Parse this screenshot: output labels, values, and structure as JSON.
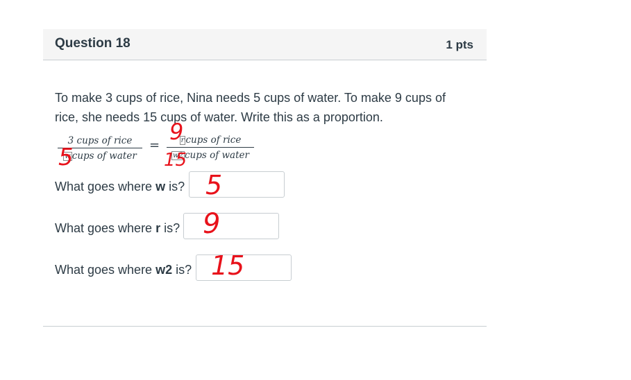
{
  "question": {
    "title": "Question 18",
    "points": "1 pts",
    "text": "To make 3 cups of rice, Nina needs 5 cups of water. To make 9 cups of rice, she needs 15 cups of water. Write this as a proportion."
  },
  "proportion": {
    "left_num": "3 cups of rice",
    "left_den_box": "w",
    "left_den_text": "cups of water",
    "equals": "=",
    "right_num_box": "r",
    "right_num_text": "cups of rice",
    "right_den_box": "w2",
    "right_den_text": "cups of water"
  },
  "handwriting": {
    "left_den": "5",
    "right_num": "9",
    "right_den": "15",
    "answer_w": "5",
    "answer_r": "9",
    "answer_w2": "15",
    "color": "#e8121b"
  },
  "fields": [
    {
      "prefix": "What goes where ",
      "var": "w",
      "suffix": " is?"
    },
    {
      "prefix": "What goes where ",
      "var": "r",
      "suffix": " is?"
    },
    {
      "prefix": "What goes where ",
      "var": "w2",
      "suffix": " is?"
    }
  ]
}
